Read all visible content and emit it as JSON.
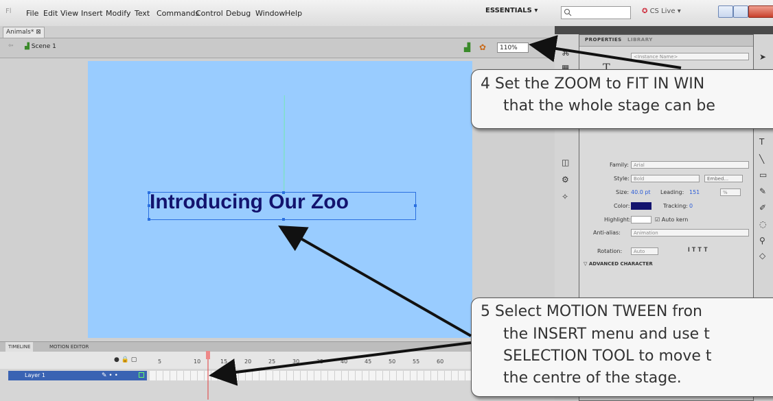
{
  "menubar": {
    "items": [
      "File",
      "Edit",
      "View",
      "Insert",
      "Modify",
      "Text",
      "Commands",
      "Control",
      "Debug",
      "Window",
      "Help"
    ],
    "workspace": "ESSENTIALS",
    "cs_live": "CS Live"
  },
  "document": {
    "tab_label": "Animals*",
    "scene_label": "Scene 1",
    "zoom_value": "110%"
  },
  "stage": {
    "text": "Introducing Our Zoo",
    "background": "#99ccff",
    "text_color": "#13136e"
  },
  "timeline": {
    "tabs": [
      "TIMELINE",
      "MOTION EDITOR"
    ],
    "frame_numbers": [
      "5",
      "10",
      "15",
      "20",
      "25",
      "30",
      "35",
      "40",
      "45",
      "50",
      "55",
      "60"
    ],
    "layer_name": "Layer 1"
  },
  "properties": {
    "tabs": [
      "PROPERTIES",
      "LIBRARY"
    ],
    "instance_name_placeholder": "<Instance Name>",
    "family_label": "Family:",
    "family_value": "Arial",
    "style_label": "Style:",
    "style_value": "Bold",
    "embed_label": "Embed...",
    "size_label": "Size:",
    "size_value": "40.0 pt",
    "leading_label": "Leading:",
    "leading_value": "151",
    "leading_unit": "%",
    "color_label": "Color:",
    "tracking_label": "Tracking:",
    "tracking_value": "0",
    "highlight_label": "Highlight:",
    "autokern_label": "Auto kern",
    "antialias_label": "Anti-alias:",
    "antialias_value": "Animation",
    "rotation_label": "Rotation:",
    "rotation_value": "Auto",
    "advanced_label": "ADVANCED CHARACTER"
  },
  "callouts": {
    "step4": [
      "4  Set the ZOOM to FIT IN WIN",
      "that the whole stage can be"
    ],
    "step5": [
      "5  Select MOTION TWEEN fron",
      "the INSERT menu and use t",
      "SELECTION TOOL to move t",
      "the centre of the stage."
    ]
  },
  "colors": {
    "selection": "#2a6fe0",
    "layer_highlight": "#3a63b3",
    "playhead": "#e03a3a"
  }
}
